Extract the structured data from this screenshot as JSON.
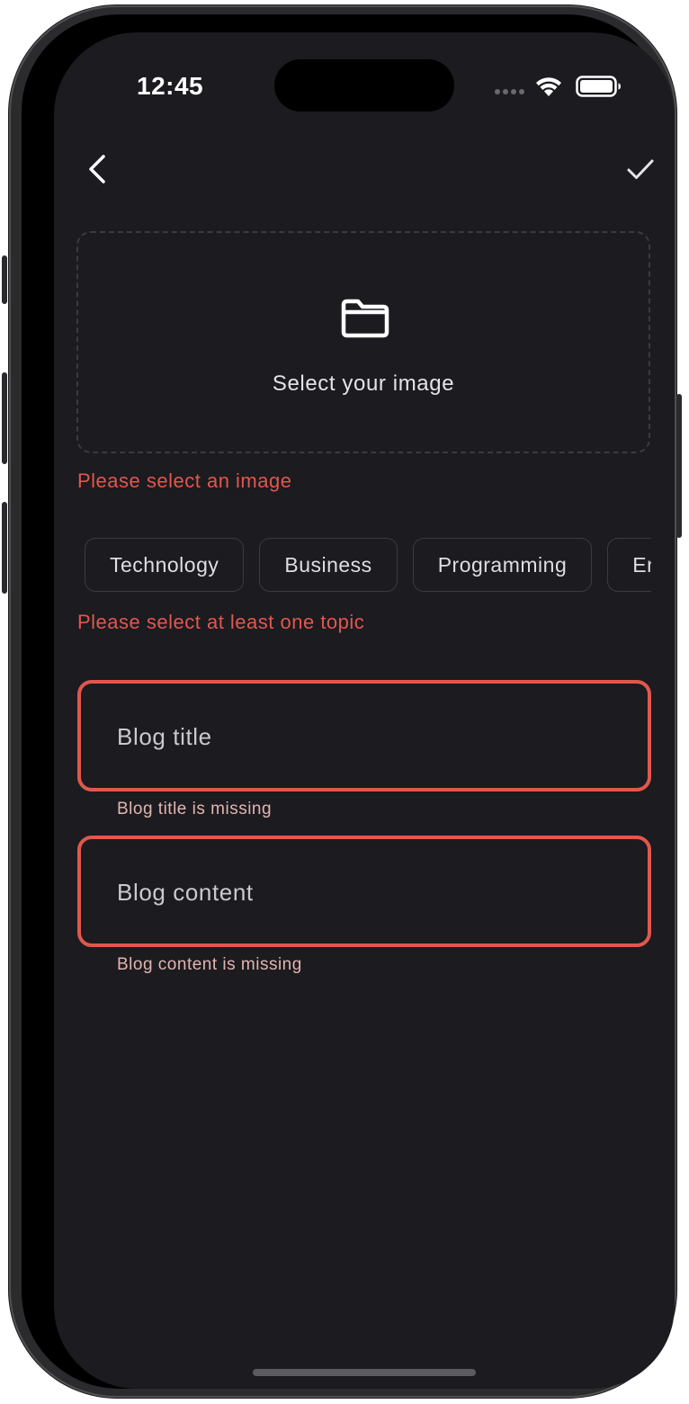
{
  "status_bar": {
    "time": "12:45"
  },
  "toolbar": {
    "back_icon": "chevron-left-icon",
    "done_icon": "checkmark-icon"
  },
  "image_picker": {
    "icon": "folder-icon",
    "label": "Select your image",
    "error": "Please select an image"
  },
  "topics": {
    "chips": [
      "Technology",
      "Business",
      "Programming",
      "Entertainment"
    ],
    "error": "Please select at least one topic"
  },
  "form": {
    "title": {
      "placeholder": "Blog title",
      "error": "Blog title is missing"
    },
    "content": {
      "placeholder": "Blog content",
      "error": "Blog content is missing"
    }
  },
  "colors": {
    "background": "#1b1b20",
    "error": "#e2574c",
    "helper_error": "#e3b5b0",
    "border_muted": "#3a3a42"
  }
}
